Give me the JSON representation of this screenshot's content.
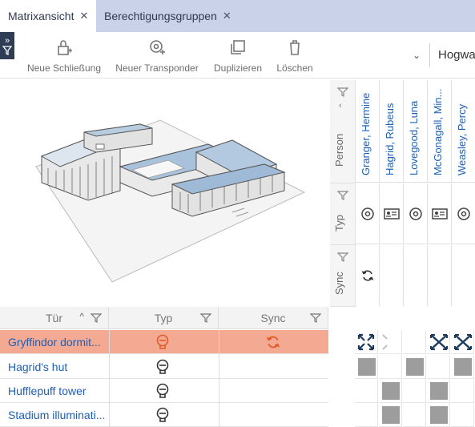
{
  "tabs": [
    {
      "label": "Matrixansicht",
      "active": true
    },
    {
      "label": "Berechtigungsgruppen",
      "active": false
    }
  ],
  "toolbar": {
    "new_lock": "Neue Schließung",
    "new_transponder": "Neuer Transponder",
    "duplicate": "Duplizieren",
    "delete": "Löschen",
    "project_select": "Hogwarts"
  },
  "header_rows": {
    "person": "Person",
    "typ": "Typ",
    "sync": "Sync"
  },
  "persons": [
    {
      "name": "Granger, Hermine",
      "type": "transponder-icon"
    },
    {
      "name": "Hagrid, Rubeus",
      "type": "card-icon"
    },
    {
      "name": "Lovegood, Luna",
      "type": "transponder-icon"
    },
    {
      "name": "McGonagall, Min...",
      "type": "card-icon"
    },
    {
      "name": "Weasley, Percy",
      "type": "transponder-icon"
    }
  ],
  "door_table": {
    "columns": [
      "Tür",
      "Typ",
      "Sync"
    ],
    "rows": [
      {
        "name": "Gryffindor dormit...",
        "selected": true,
        "sync": true
      },
      {
        "name": "Hagrid's hut",
        "selected": false,
        "sync": false
      },
      {
        "name": "Hufflepuff tower",
        "selected": false,
        "sync": false
      },
      {
        "name": "Stadium illuminati...",
        "selected": false,
        "sync": false
      }
    ]
  },
  "matrix": [
    [
      "expand",
      "expand-faint",
      "",
      "cross",
      "cross"
    ],
    [
      "filled",
      "",
      "filled",
      "",
      "filled"
    ],
    [
      "",
      "filled",
      "",
      "filled",
      ""
    ],
    [
      "",
      "filled",
      "",
      "filled",
      ""
    ]
  ],
  "colors": {
    "tabbar": "#c9d2e8",
    "selected_row": "#f4a992",
    "link_blue": "#1f5fb4",
    "accent_orange": "#e05a2a",
    "dark_navy": "#2e3d55"
  }
}
